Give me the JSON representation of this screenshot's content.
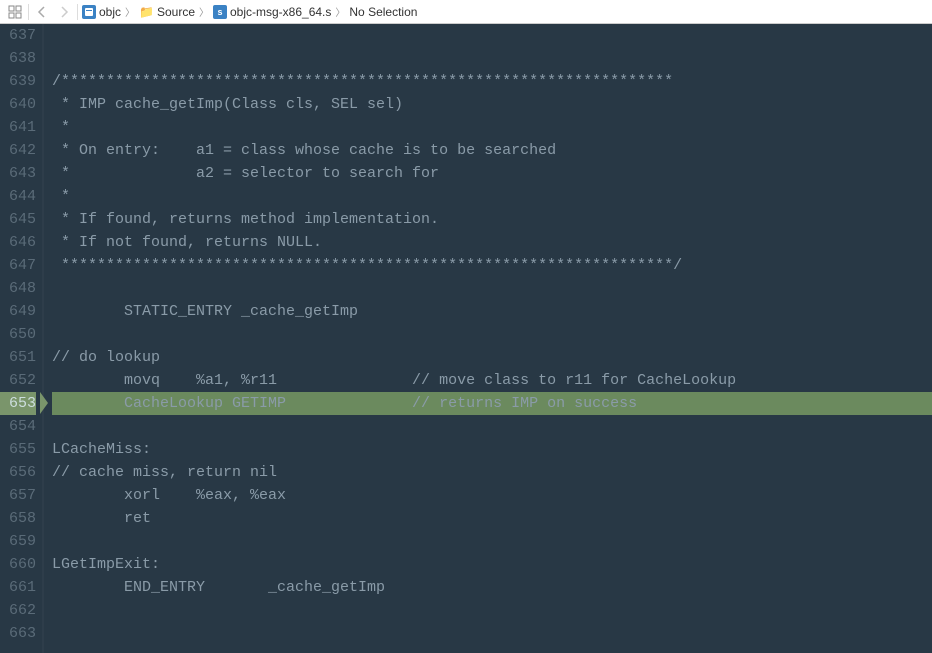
{
  "breadcrumb": {
    "items": [
      {
        "icon": "blue",
        "glyph": "📄",
        "label": "objc"
      },
      {
        "icon": "folder",
        "glyph": "📁",
        "label": "Source"
      },
      {
        "icon": "file",
        "glyph": "s",
        "label": "objc-msg-x86_64.s"
      },
      {
        "icon": "",
        "glyph": "",
        "label": "No Selection"
      }
    ]
  },
  "startLine": 637,
  "highlightedLine": 653,
  "code": [
    "",
    "",
    "/********************************************************************",
    " * IMP cache_getImp(Class cls, SEL sel)",
    " *",
    " * On entry:    a1 = class whose cache is to be searched",
    " *              a2 = selector to search for",
    " *",
    " * If found, returns method implementation.",
    " * If not found, returns NULL.",
    " ********************************************************************/",
    "",
    "        STATIC_ENTRY _cache_getImp",
    "",
    "// do lookup",
    "        movq    %a1, %r11               // move class to r11 for CacheLookup",
    "        CacheLookup GETIMP              // returns IMP on success",
    "",
    "LCacheMiss:",
    "// cache miss, return nil",
    "        xorl    %eax, %eax",
    "        ret",
    "",
    "LGetImpExit:",
    "        END_ENTRY       _cache_getImp",
    "",
    ""
  ]
}
